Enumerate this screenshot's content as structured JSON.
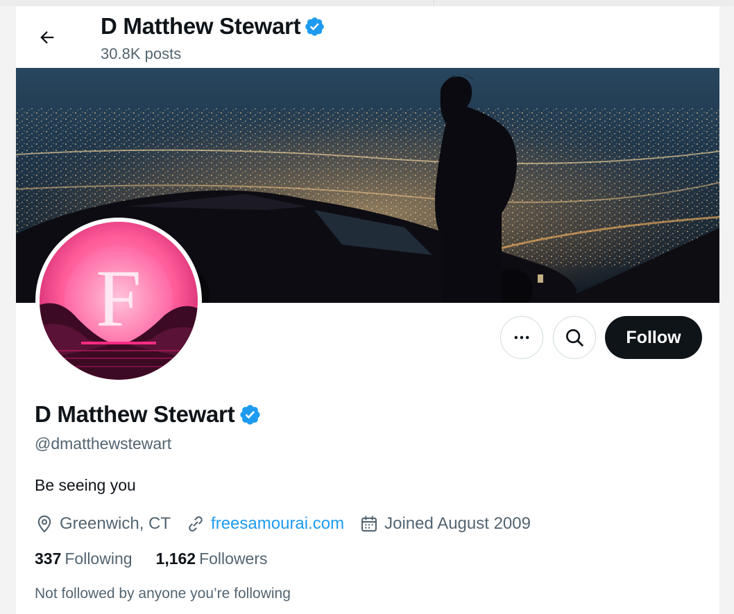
{
  "header": {
    "back_icon": "arrow-left-icon",
    "name": "D Matthew Stewart",
    "posts": "30.8K posts",
    "verified_icon": "verified-badge-icon"
  },
  "banner": {
    "description_icon": "banner-image"
  },
  "avatar": {
    "letter": "F",
    "colors": {
      "glow": "#ff6fa8",
      "dark": "#3d0a24"
    }
  },
  "actions": {
    "more_icon": "more-horizontal-icon",
    "search_icon": "search-icon",
    "follow_label": "Follow"
  },
  "profile": {
    "name": "D Matthew Stewart",
    "handle": "@dmatthewstewart",
    "bio": "Be seeing you",
    "location": "Greenwich, CT",
    "website": "freesamourai.com",
    "joined": "Joined August 2009"
  },
  "stats": {
    "following_count": "337",
    "following_label": "Following",
    "followers_count": "1,162",
    "followers_label": "Followers"
  },
  "footer_note": "Not followed by anyone you’re following",
  "colors": {
    "accent": "#1d9bf0",
    "text": "#0f1419",
    "muted": "#536471",
    "follow_bg": "#0f1419"
  }
}
